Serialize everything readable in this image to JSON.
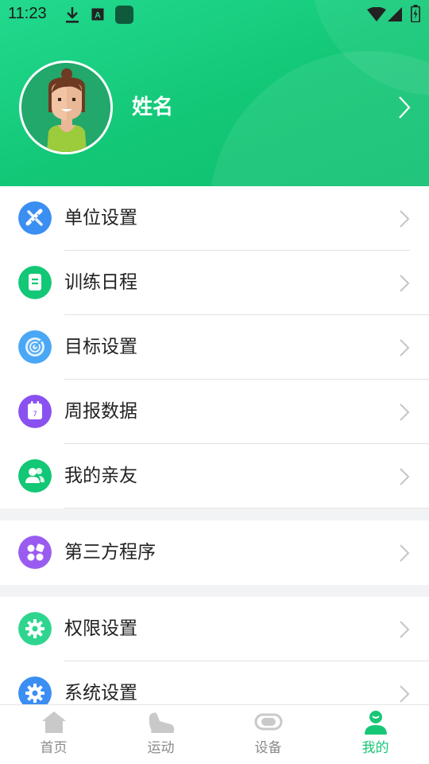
{
  "status_bar": {
    "time": "11:23"
  },
  "profile": {
    "name": "姓名"
  },
  "menu_group_1": [
    {
      "label": "单位设置",
      "icon": "ruler-pencil-icon",
      "color": "#3b8ef2"
    },
    {
      "label": "训练日程",
      "icon": "notebook-icon",
      "color": "#12c776"
    },
    {
      "label": "目标设置",
      "icon": "target-icon",
      "color": "#49a7f5"
    },
    {
      "label": "周报数据",
      "icon": "calendar-icon",
      "color": "#8a50f0"
    },
    {
      "label": "我的亲友",
      "icon": "friends-icon",
      "color": "#12c776"
    }
  ],
  "menu_group_2": [
    {
      "label": "第三方程序",
      "icon": "apps-icon",
      "color": "#9a5cf0"
    }
  ],
  "menu_group_3": [
    {
      "label": "权限设置",
      "icon": "gear-icon",
      "color": "#2fd58f"
    },
    {
      "label": "系统设置",
      "icon": "gear-icon",
      "color": "#3b8ef2"
    }
  ],
  "bottom_nav": [
    {
      "label": "首页",
      "icon": "home-icon",
      "active": false
    },
    {
      "label": "运动",
      "icon": "shoe-icon",
      "active": false
    },
    {
      "label": "设备",
      "icon": "band-icon",
      "active": false
    },
    {
      "label": "我的",
      "icon": "person-icon",
      "active": true
    }
  ],
  "colors": {
    "brand": "#12c776",
    "header_start": "#22d98e",
    "text": "#222222",
    "nav_inactive": "#8a8a8a"
  }
}
